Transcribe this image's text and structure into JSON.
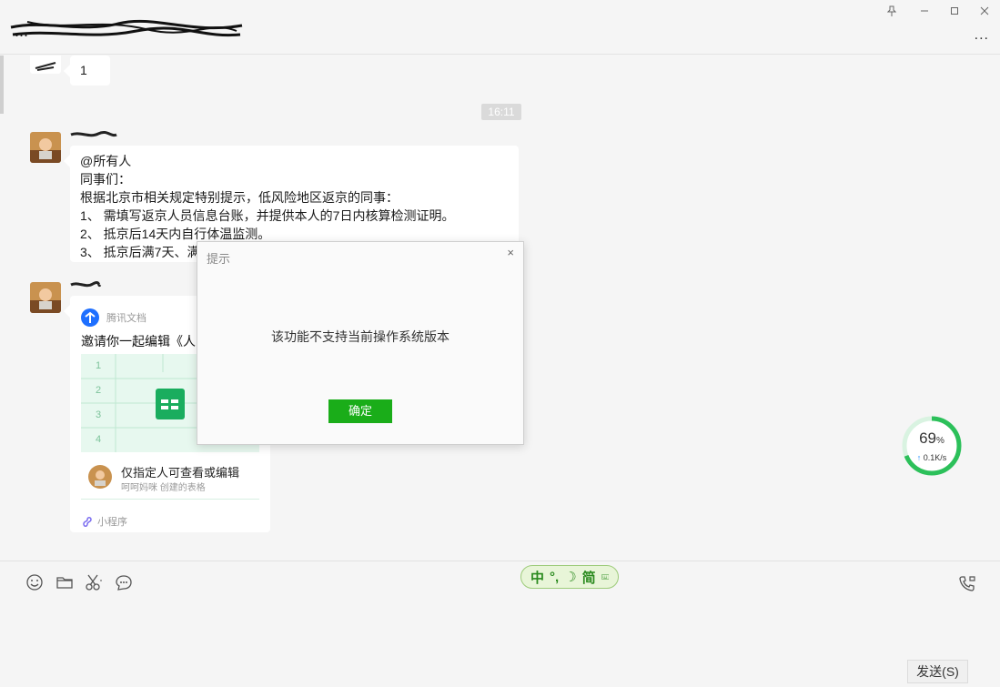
{
  "window": {
    "title": "...",
    "pin_icon": "pin-icon",
    "minimize_icon": "minimize-icon",
    "maximize_icon": "maximize-icon",
    "close_icon": "close-icon",
    "more_label": "..."
  },
  "chat": {
    "first_message": "1",
    "timestamp": "16:11",
    "notice": {
      "lines": [
        "@所有人",
        "同事们：",
        "根据北京市相关规定特别提示，低风险地区返京的同事：",
        "1、  需填写返京人员信息台账，并提供本人的7日内核算检测证明。",
        "2、  抵京后14天内自行体温监测。",
        "3、  抵京后满7天、满"
      ]
    },
    "card": {
      "source": "腾讯文档",
      "title": "邀请你一起编辑《人",
      "row_numbers": [
        "1",
        "2",
        "3",
        "4"
      ],
      "permission": "仅指定人可查看或编辑",
      "creator": "呵呵妈咪 创建的表格",
      "footer": "小程序"
    }
  },
  "dialog": {
    "title": "提示",
    "message": "该功能不支持当前操作系统版本",
    "ok_label": "确定",
    "close_label": "×"
  },
  "network_widget": {
    "percent": "69",
    "percent_unit": "%",
    "speed": "0.1K/s",
    "ring_fraction": 0.69
  },
  "input": {
    "ime_text": "中",
    "ime_mode": "简",
    "send_label": "发送(S)"
  },
  "colors": {
    "accent_green": "#1aad19",
    "ring_green": "#2cc05a"
  }
}
